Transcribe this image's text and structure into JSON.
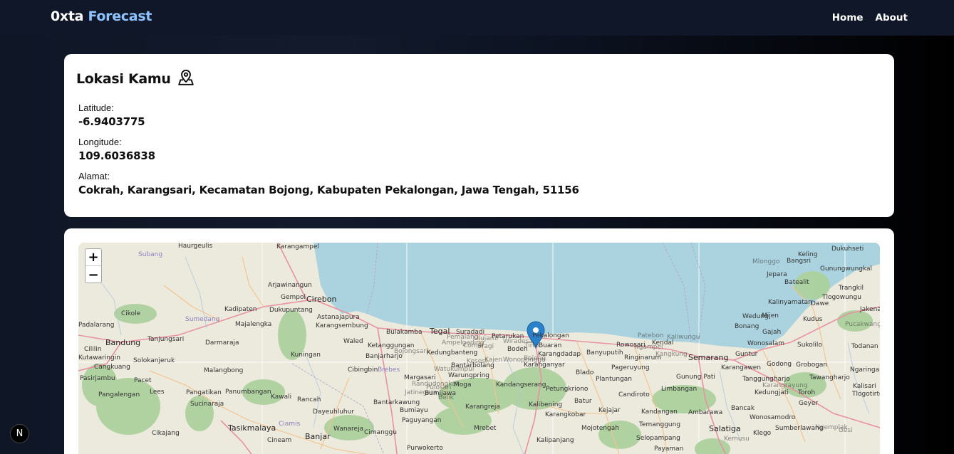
{
  "nav": {
    "brand_part1": "0xta",
    "brand_part2": "Forecast",
    "home": "Home",
    "about": "About"
  },
  "location": {
    "title": "Lokasi Kamu",
    "latitude_label": "Latitude:",
    "latitude_value": "-6.9403775",
    "longitude_label": "Longitude:",
    "longitude_value": "109.6036838",
    "address_label": "Alamat:",
    "address_value": "Cokrah, Karangsari, Kecamatan Bojong, Kabupaten Pekalongan, Jawa Tengah, 51156"
  },
  "map": {
    "zoom_in": "+",
    "zoom_out": "−",
    "labels": [
      "Haurgeulis",
      "Karangampel",
      "Subang",
      "Arjawinangun",
      "Gempol",
      "Cirebon",
      "Kadipaten",
      "Dukupuntang",
      "Cikole",
      "Sumedang",
      "Majalengka",
      "Astanajapura",
      "Karangsembung",
      "Padalarang",
      "Bandung",
      "Tanjungsari",
      "Darmaraja",
      "Waled",
      "Ketanggungan",
      "Bulakamba",
      "Tegal",
      "Suradadi",
      "Petarukan",
      "Pekalongan",
      "Buaran",
      "Bodeh",
      "Karangdadap",
      "Banyuputih",
      "Rowosari",
      "Kendal",
      "Semarang",
      "Kuningan",
      "Banjarharjo",
      "Kedungbanteng",
      "Cibingbin",
      "Brebes",
      "Margasari",
      "Bantarbolang",
      "Karanganyar",
      "Blado",
      "Pageruyung",
      "Gunung Pati",
      "Malangbong",
      "Pacet",
      "Cangkuang",
      "Pasirjambu",
      "Lees",
      "Pangatikan",
      "Panumbangan",
      "Kawali",
      "Rancah",
      "Bumijawa",
      "Warungpring",
      "Moga",
      "Kandangserang",
      "Petungkriono",
      "Plantungan",
      "Candiroto",
      "Limbangan",
      "Pangalengan",
      "Sucinaraja",
      "Dayeuhluhur",
      "Bantarkawung",
      "Bumiayu",
      "Karangreja",
      "Kalibening",
      "Batur",
      "Kejajar",
      "Kandangan",
      "Ambarawa",
      "Tasikmalaya",
      "Ciamis",
      "Banjar",
      "Wanareja",
      "Cimanggu",
      "Paguyangan",
      "Mrebet",
      "Karangkobar",
      "Mojotengah",
      "Temanggung",
      "Salatiga",
      "Cikajang",
      "Cineam",
      "Purwokerto",
      "Kalipanjang",
      "Selopampang",
      "Payaman",
      "Keling",
      "Bangsri",
      "Dukuhseti",
      "Jepara",
      "Gunungwungkal",
      "Batealit",
      "Trangkil",
      "Mlonggo",
      "Kalinyamatan",
      "Dawe",
      "Jakenan",
      "Tlogowungu",
      "Wedung",
      "Mijen",
      "Kudus",
      "Pucakwangi",
      "Bonang",
      "Gajah",
      "Wonosalam",
      "Sukolilo",
      "Todanan",
      "Guntur",
      "Godong",
      "Grobogan",
      "Ngaringan",
      "Karangawen",
      "Tanggungharjo",
      "Tawangharjo",
      "Kalisari",
      "Kedungjati",
      "Toroh",
      "Tlogotirto",
      "Bancak",
      "Wonosamodro",
      "Geyer",
      "Kemusu",
      "Klego",
      "Sumberlawang",
      "Ngemplak",
      "Gesi",
      "Karangrayung",
      "Ringinarum",
      "Kutawaringin",
      "Solokanjeruk",
      "Cililin",
      "Kangkung",
      "Ngampel",
      "Patebon",
      "Kaliwungu",
      "Sragi",
      "Wiradesa",
      "Tirto",
      "Bojong",
      "Wonopringgo",
      "Kajen",
      "Kesesi",
      "Comal",
      "Ampelgading",
      "Randudongkal",
      "Belik",
      "Watukumpul",
      "Pulosari",
      "Jatinegara",
      "Bojongsari",
      "Pemalang",
      "Ulujami"
    ]
  },
  "badge": {
    "letter": "N"
  },
  "colors": {
    "navbar": "#0f1729",
    "brand_accent": "#8ec3ff",
    "sea": "#aad3df",
    "land": "#e9e6d8",
    "forest": "#add19e",
    "road_primary": "#e892a2",
    "road_secondary": "#f4c38b",
    "marker": "#2a81cb"
  }
}
